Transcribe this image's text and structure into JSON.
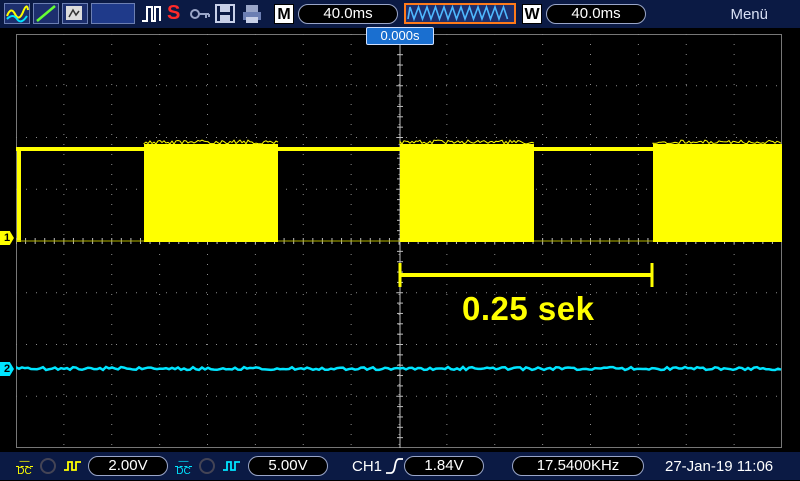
{
  "topbar": {
    "timebase_main_label": "M",
    "timebase_main_value": "40.0ms",
    "timebase_window_label": "W",
    "timebase_window_value": "40.0ms",
    "menu_label": "Menü",
    "run_state_letter": "S"
  },
  "trigger_position_label": "0.000s",
  "channels": {
    "ch1": {
      "marker": "1",
      "color": "#ffff00",
      "coupling": "DC",
      "scale": "2.00V"
    },
    "ch2": {
      "marker": "2",
      "color": "#00e5ff",
      "coupling": "DC",
      "scale": "5.00V"
    }
  },
  "trigger": {
    "source": "CH1",
    "level": "1.84V"
  },
  "frequency": "17.5400KHz",
  "datetime": "27-Jan-19 11:06",
  "annotation": {
    "text": "0.25 sek"
  },
  "icons": [
    "waveform-icon",
    "cursor-icon",
    "screenshot-icon",
    "math-icon",
    "pulse-icon",
    "stop-icon",
    "key-icon",
    "save-icon",
    "print-icon",
    "zoom-wave-icon"
  ]
}
